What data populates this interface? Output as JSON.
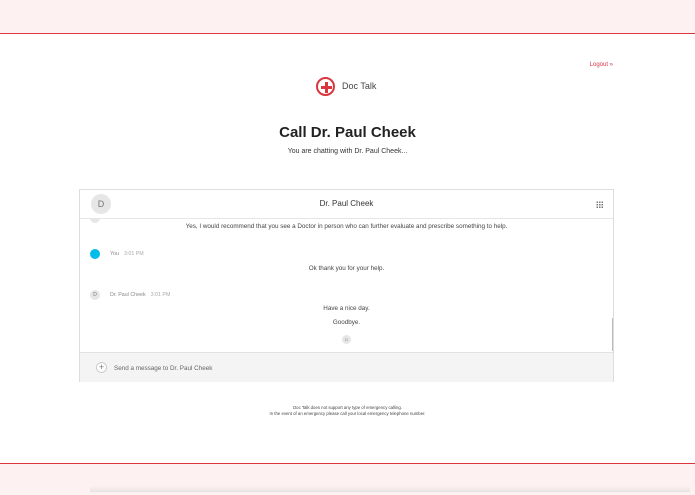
{
  "header": {
    "logout_label": "Logout »",
    "brand": {
      "name": "Doc Talk",
      "icon": "red-cross-icon",
      "color": "#d9363e"
    }
  },
  "page": {
    "title": "Call Dr. Paul Cheek",
    "subtitle": "You are chatting with Dr. Paul Cheek..."
  },
  "chat": {
    "header": {
      "avatar_initial": "D",
      "title": "Dr. Paul Cheek"
    },
    "messages": [
      {
        "text": "Yes, I would recommend that you see a Doctor in person who can further evaluate and prescribe something to help."
      },
      {
        "author": "You",
        "time": "3:01 PM",
        "text": "Ok thank you for your help."
      },
      {
        "author": "Dr. Paul Cheek",
        "avatar_initial": "D",
        "time": "3:01 PM",
        "lines": [
          "Have a nice day.",
          "Goodbye."
        ]
      }
    ],
    "typing_avatar_initial": "D",
    "composer": {
      "plus_symbol": "+",
      "placeholder": "Send a message to Dr. Paul Cheek"
    }
  },
  "footer": {
    "line1": "Doc Talk does not support any type of emergency calling.",
    "line2": "In the event of an emergency please call your local emergency telephone number."
  },
  "colors": {
    "accent": "#d9363e",
    "you_avatar": "#00bceb",
    "band": "#fdf1f1"
  }
}
